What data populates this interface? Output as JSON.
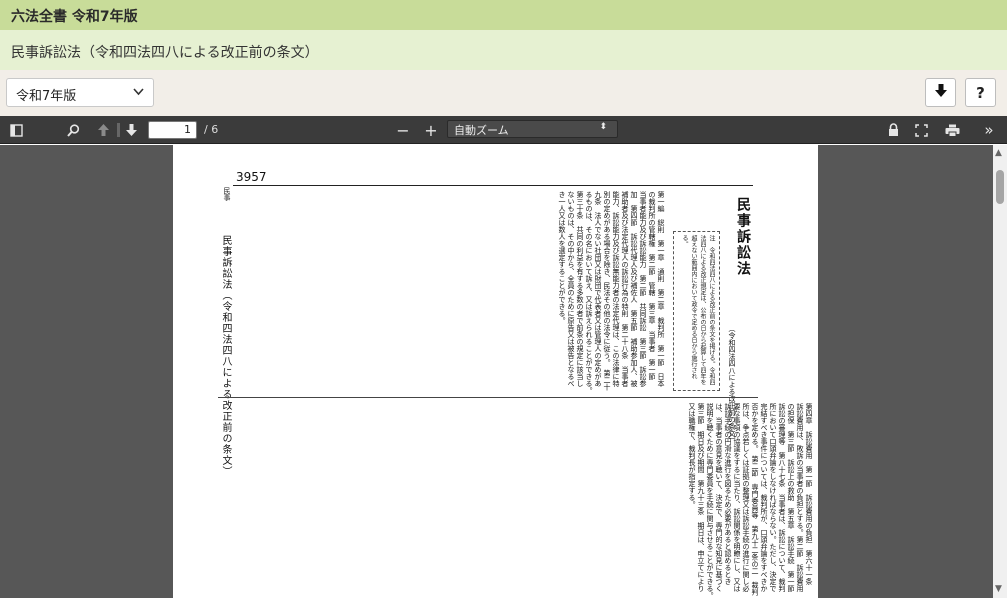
{
  "header": {
    "title": "六法全書 令和7年版",
    "subtitle": "民事訴訟法（令和四法四八による改正前の条文）"
  },
  "controls": {
    "year_select_value": "令和7年版",
    "download_icon": "download-arrow-icon",
    "help_label": "?"
  },
  "pdf_toolbar": {
    "page_current": "1",
    "page_total": "/ 6",
    "zoom_minus": "−",
    "zoom_plus": "+",
    "zoom_value": "自動ズーム"
  },
  "document": {
    "page_number": "3957",
    "law_title": "民事訴訟法",
    "law_note": "（令和四法四八による改正前の条文）",
    "side_heading": "民事",
    "side_title": "民事訴訟法（令和四法四八による改正前の条文）",
    "note_box": "注　令和四法四八による改正前の条文を掲げる。令和四法四八による改正規定は、公布の日から起算して四年を超えない範囲内において政令で定める日から施行される。",
    "upper_text": "第一編　総則　第一章　通則　第二章　裁判所　第一節　日本の裁判所の管轄権　第二節　管轄　第三章　当事者　第一節　当事者能力及び訴訟能力　第二節　共同訴訟　第三節　訴訟参加　第四節　訴訟代理人及び補佐人　第五節　補助参加人、被補助者及び法定代理人の訴訟行為の特則　第二十八条　当事者能力、訴訟能力及び訴訟無能力者の法定代理は、この法律に特別の定めがある場合を除き、民法その他の法令に従う。　第二十九条　法人でない社団又は財団で代表者又は管理人の定めがあるものは、その名において訴え、又は訴えられることができる。　第三十条　共同の利益を有する多数の者で前条の規定に該当しないものは、その中から、全員のために原告又は被告となるべき一人又は数人を選定することができる。",
    "lower_text": "第四章　訴訟費用　第一節　訴訟費用の負担　第六十一条　訴訟費用は、敗訴の当事者の負担とする。第二節　訴訟費用の担保　第三節　訴訟上の救助　第五章　訴訟手続　第一節　訴訟の審理等　第八十七条　当事者は、訴訟について、裁判所において口頭弁論をしなければならない。ただし、決定で完結すべき事件については、裁判所が、口頭弁論をすべきか否かを定める。　第二節　専門委員等　第九十二条の二　裁判所は、争点若しくは証拠の整理又は訴訟手続の進行に関し必要な事項の協議をするに当たり、訴訟関係を明瞭にし、又は訴訟手続の円滑な進行を図るため必要があると認めるときは、当事者の意見を聴いて、決定で、専門的な知見に基づく説明を聴くために専門委員を手続に関与させることができる。　第三節　期日及び期間　第九十三条　期日は、申立てにより又は職権で、裁判長が指定する。"
  },
  "colors": {
    "title_bar_bg": "#c8dc99",
    "sub_bar_bg": "#e6f1d2",
    "control_bar_bg": "#f2eee8",
    "pdf_toolbar_bg": "#3b3b3b",
    "viewer_bg": "#575757"
  }
}
